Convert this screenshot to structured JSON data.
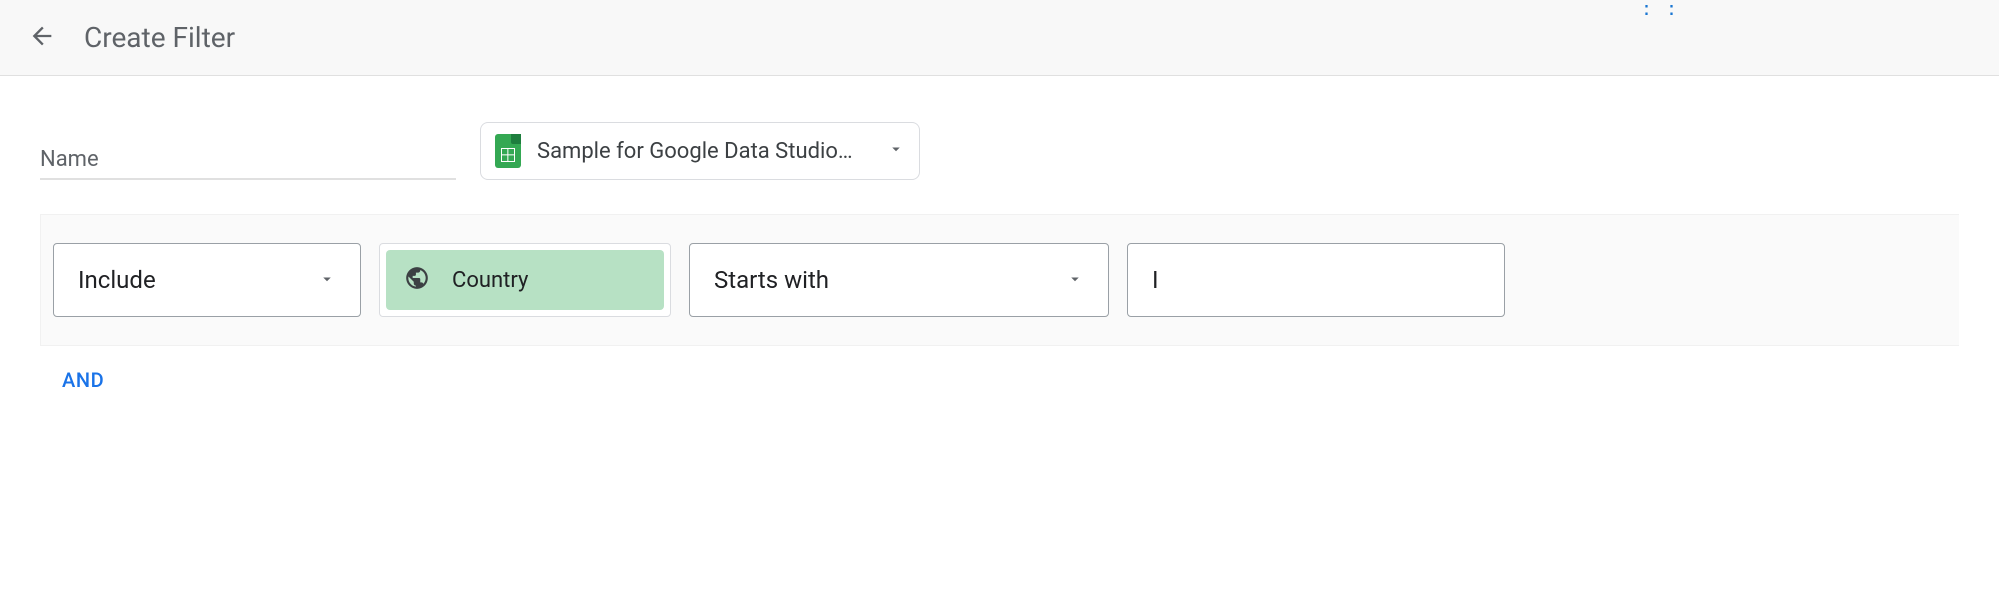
{
  "header": {
    "title": "Create Filter"
  },
  "form": {
    "name_label": "Name",
    "source_selected": "Sample for Google Data Studio - S…"
  },
  "rule": {
    "mode": "Include",
    "dimension": "Country",
    "condition": "Starts with",
    "value": "I"
  },
  "controls": {
    "and_label": "AND"
  }
}
